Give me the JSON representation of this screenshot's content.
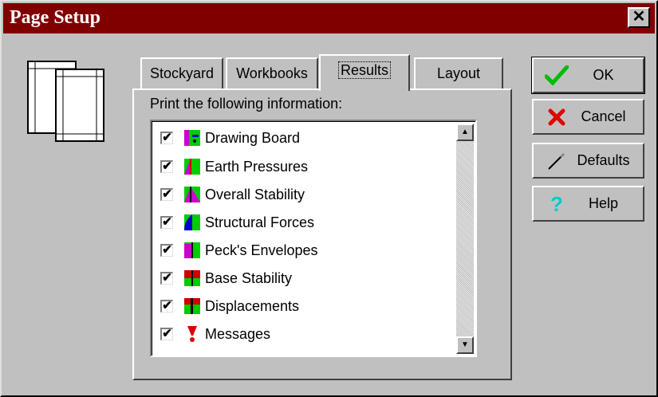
{
  "window": {
    "title": "Page Setup",
    "close_glyph": "✕"
  },
  "tabs": [
    {
      "label": "Stockyard",
      "active": false
    },
    {
      "label": "Workbooks",
      "active": false
    },
    {
      "label": "Results",
      "active": true
    },
    {
      "label": "Layout",
      "active": false
    }
  ],
  "panel": {
    "label": "Print the following information:",
    "items": [
      {
        "label": "Drawing Board",
        "checked": true,
        "icon": "drawing-board-icon"
      },
      {
        "label": "Earth Pressures",
        "checked": true,
        "icon": "earth-pressures-icon"
      },
      {
        "label": "Overall Stability",
        "checked": true,
        "icon": "overall-stability-icon"
      },
      {
        "label": "Structural Forces",
        "checked": true,
        "icon": "structural-forces-icon"
      },
      {
        "label": "Peck's Envelopes",
        "checked": true,
        "icon": "pecks-envelopes-icon"
      },
      {
        "label": "Base Stability",
        "checked": true,
        "icon": "base-stability-icon"
      },
      {
        "label": "Displacements",
        "checked": true,
        "icon": "displacements-icon"
      },
      {
        "label": "Messages",
        "checked": true,
        "icon": "messages-icon"
      }
    ]
  },
  "buttons": {
    "ok": "OK",
    "cancel": "Cancel",
    "defaults": "Defaults",
    "help": "Help"
  },
  "colors": {
    "title_bar": "#800000",
    "face": "#c0c0c0",
    "accent_green": "#00cc00",
    "accent_magenta": "#cc00cc"
  }
}
